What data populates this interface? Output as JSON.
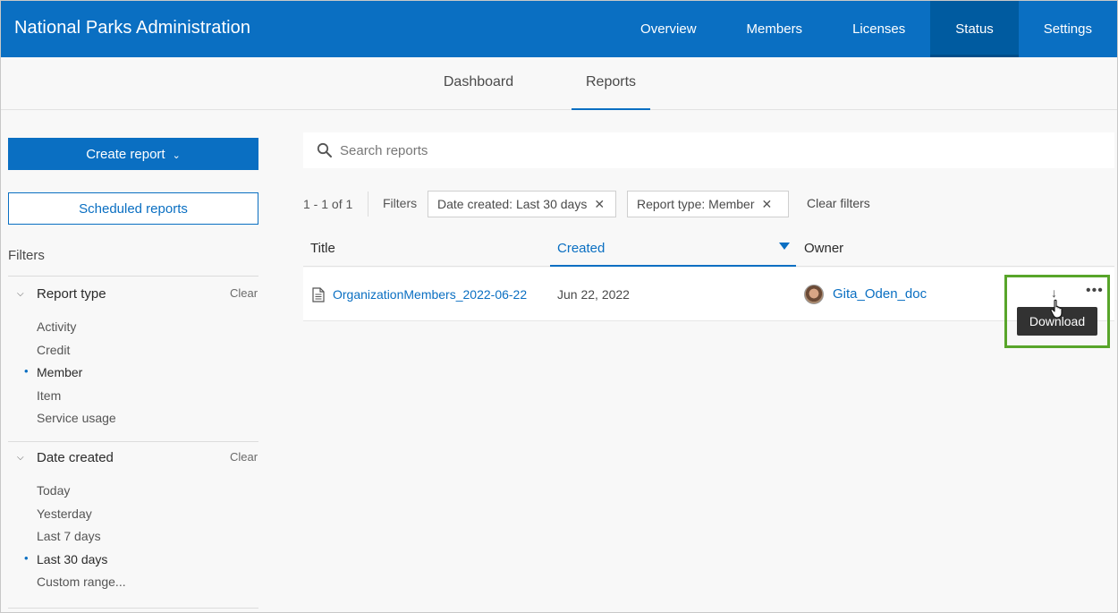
{
  "header": {
    "title": "National Parks Administration",
    "nav": [
      "Overview",
      "Members",
      "Licenses",
      "Status",
      "Settings"
    ],
    "active_nav": "Status"
  },
  "subnav": {
    "tabs": [
      "Dashboard",
      "Reports"
    ],
    "active_tab": "Reports"
  },
  "sidebar": {
    "create_report_label": "Create report",
    "scheduled_reports_label": "Scheduled reports",
    "filters_label": "Filters",
    "report_type": {
      "label": "Report type",
      "clear_label": "Clear",
      "options": [
        "Activity",
        "Credit",
        "Member",
        "Item",
        "Service usage"
      ],
      "selected": "Member"
    },
    "date_created": {
      "label": "Date created",
      "clear_label": "Clear",
      "options": [
        "Today",
        "Yesterday",
        "Last 7 days",
        "Last 30 days",
        "Custom range..."
      ],
      "selected": "Last 30 days"
    }
  },
  "search": {
    "placeholder": "Search reports",
    "value": ""
  },
  "filter_bar": {
    "count": "1 - 1 of 1",
    "filters_label": "Filters",
    "chips": [
      "Date created: Last 30 days",
      "Report type: Member"
    ],
    "clear_filters_label": "Clear filters"
  },
  "table": {
    "columns": [
      "Title",
      "Created",
      "Owner"
    ],
    "sorted_column": "Created",
    "rows": [
      {
        "title": "OrganizationMembers_2022-06-22",
        "created": "Jun 22, 2022",
        "owner": "Gita_Oden_doc"
      }
    ],
    "tooltip": "Download"
  },
  "colors": {
    "brand": "#0a6fc2",
    "highlight": "#58a52a"
  }
}
